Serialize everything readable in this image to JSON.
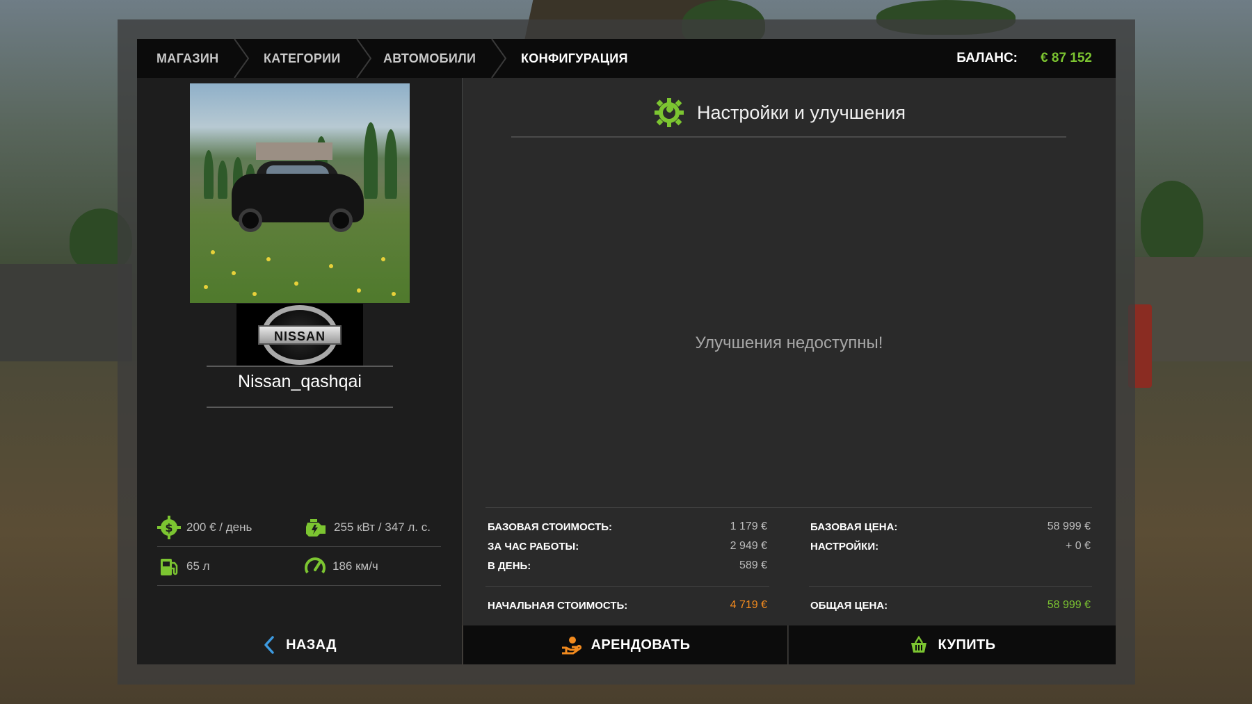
{
  "breadcrumbs": [
    "МАГАЗИН",
    "КАТЕГОРИИ",
    "АВТОМОБИЛИ",
    "КОНФИГУРАЦИЯ"
  ],
  "balance": {
    "label": "БАЛАНС:",
    "value": "€ 87 152"
  },
  "vehicle": {
    "brand": "NISSAN",
    "name": "Nissan_qashqai",
    "stats": {
      "daily_cost": "200 € / день",
      "power": "255 кВт / 347 л. с.",
      "fuel": "65 л",
      "speed": "186 км/ч"
    }
  },
  "config": {
    "title": "Настройки и улучшения",
    "message": "Улучшения недоступны!"
  },
  "costs": {
    "left": [
      {
        "label": "БАЗОВАЯ СТОИМОСТЬ:",
        "value": "1 179 €"
      },
      {
        "label": "ЗА ЧАС РАБОТЫ:",
        "value": "2 949 €"
      },
      {
        "label": "В ДЕНЬ:",
        "value": "589 €"
      }
    ],
    "left_total": {
      "label": "НАЧАЛЬНАЯ СТОИМОСТЬ:",
      "value": "4 719 €"
    },
    "right": [
      {
        "label": "БАЗОВАЯ ЦЕНА:",
        "value": "58 999 €"
      },
      {
        "label": "НАСТРОЙКИ:",
        "value": "+ 0 €"
      }
    ],
    "right_total": {
      "label": "ОБЩАЯ ЦЕНА:",
      "value": "58 999 €"
    }
  },
  "buttons": {
    "back": "НАЗАД",
    "rent": "АРЕНДОВАТЬ",
    "buy": "КУПИТЬ"
  },
  "colors": {
    "accent_green": "#7cc531",
    "accent_orange": "#f28a1e",
    "bar": "#0b0b0b"
  }
}
